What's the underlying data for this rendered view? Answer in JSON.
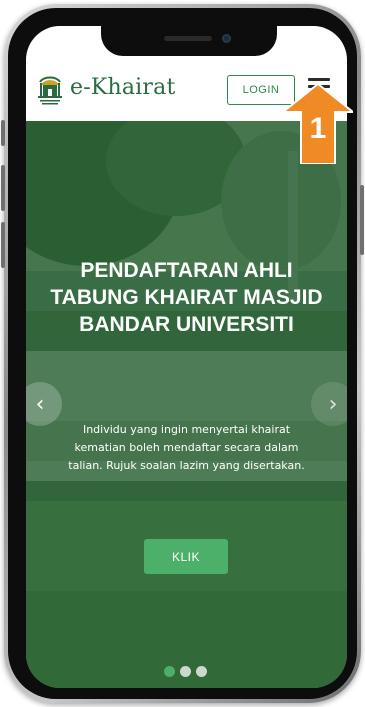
{
  "header": {
    "logo_name": "e-Khairat",
    "login_label": "LOGIN",
    "menu_icon": "hamburger-menu-icon"
  },
  "hero": {
    "title": "PENDAFTARAN AHLI TABUNG KHAIRAT MASJID BANDAR UNIVERSITI",
    "description": "Individu yang ingin menyertai khairat kematian boleh mendaftar secara dalam talian. Rujuk soalan lazim yang disertakan.",
    "button_label": "KLIK",
    "prev_icon": "chevron-left-icon",
    "next_icon": "chevron-right-icon",
    "slide_count": 3,
    "active_slide": 1
  },
  "annotation": {
    "callout_number": "1"
  },
  "colors": {
    "brand_green": "#2e8a4d",
    "button_green": "#4caf6a",
    "callout_orange": "#f08a24"
  }
}
